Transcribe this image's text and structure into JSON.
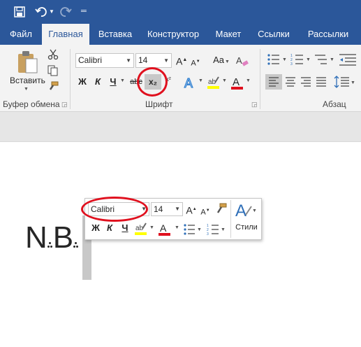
{
  "ribbon": {
    "tabs": [
      "Файл",
      "Главная",
      "Вставка",
      "Конструктор",
      "Макет",
      "Ссылки",
      "Рассылки"
    ],
    "active_tab": "Главная",
    "clipboard": {
      "paste_label": "Вставить",
      "group_label": "Буфер обмена"
    },
    "font": {
      "font_name": "Calibri",
      "font_size": "14",
      "bold": "Ж",
      "italic": "К",
      "underline": "Ч",
      "strike": "abc",
      "subscript": "x₂",
      "superscript": "x²",
      "change_case": "Aa",
      "grow": "A",
      "shrink": "A",
      "group_label": "Шрифт"
    },
    "paragraph": {
      "group_label": "Абзац"
    }
  },
  "document": {
    "text_main": "N",
    "text_dot": ".",
    "text_b": "B"
  },
  "mini_toolbar": {
    "font_name": "Calibri",
    "font_size": "14",
    "bold": "Ж",
    "italic": "К",
    "underline": "Ч",
    "styles_label": "Стили"
  },
  "colors": {
    "ribbon_blue": "#2b579a",
    "highlight": "#e0101e",
    "marker_yellow": "#ffff00",
    "font_red": "#e0101e"
  }
}
